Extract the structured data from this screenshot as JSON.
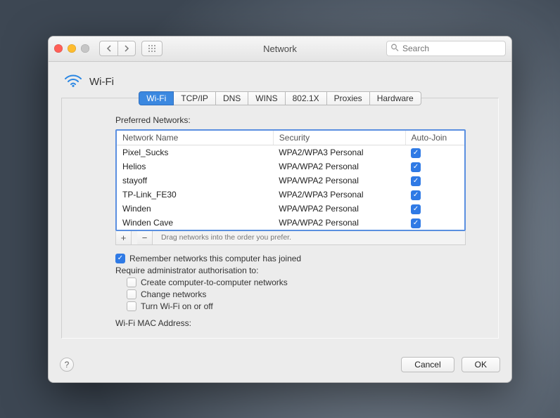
{
  "window": {
    "title": "Network"
  },
  "search": {
    "placeholder": "Search"
  },
  "panel": {
    "name": "Wi-Fi"
  },
  "tabs": [
    {
      "label": "Wi-Fi"
    },
    {
      "label": "TCP/IP"
    },
    {
      "label": "DNS"
    },
    {
      "label": "WINS"
    },
    {
      "label": "802.1X"
    },
    {
      "label": "Proxies"
    },
    {
      "label": "Hardware"
    }
  ],
  "preferred_label": "Preferred Networks:",
  "cols": {
    "name": "Network Name",
    "security": "Security",
    "autojoin": "Auto-Join"
  },
  "networks": [
    {
      "name": "Pixel_Sucks",
      "security": "WPA2/WPA3 Personal",
      "autojoin": true
    },
    {
      "name": "Helios",
      "security": "WPA/WPA2 Personal",
      "autojoin": true
    },
    {
      "name": "stayoff",
      "security": "WPA/WPA2 Personal",
      "autojoin": true
    },
    {
      "name": "TP-Link_FE30",
      "security": "WPA2/WPA3 Personal",
      "autojoin": true
    },
    {
      "name": "Winden",
      "security": "WPA/WPA2 Personal",
      "autojoin": true
    },
    {
      "name": "Winden Cave",
      "security": "WPA/WPA2 Personal",
      "autojoin": true
    }
  ],
  "drag_hint": "Drag networks into the order you prefer.",
  "remember": {
    "label": "Remember networks this computer has joined",
    "checked": true
  },
  "admin_label": "Require administrator authorisation to:",
  "admin_opts": [
    {
      "label": "Create computer-to-computer networks",
      "checked": false
    },
    {
      "label": "Change networks",
      "checked": false
    },
    {
      "label": "Turn Wi-Fi on or off",
      "checked": false
    }
  ],
  "mac_label": "Wi-Fi MAC Address:",
  "mac_value": "",
  "buttons": {
    "cancel": "Cancel",
    "ok": "OK"
  }
}
